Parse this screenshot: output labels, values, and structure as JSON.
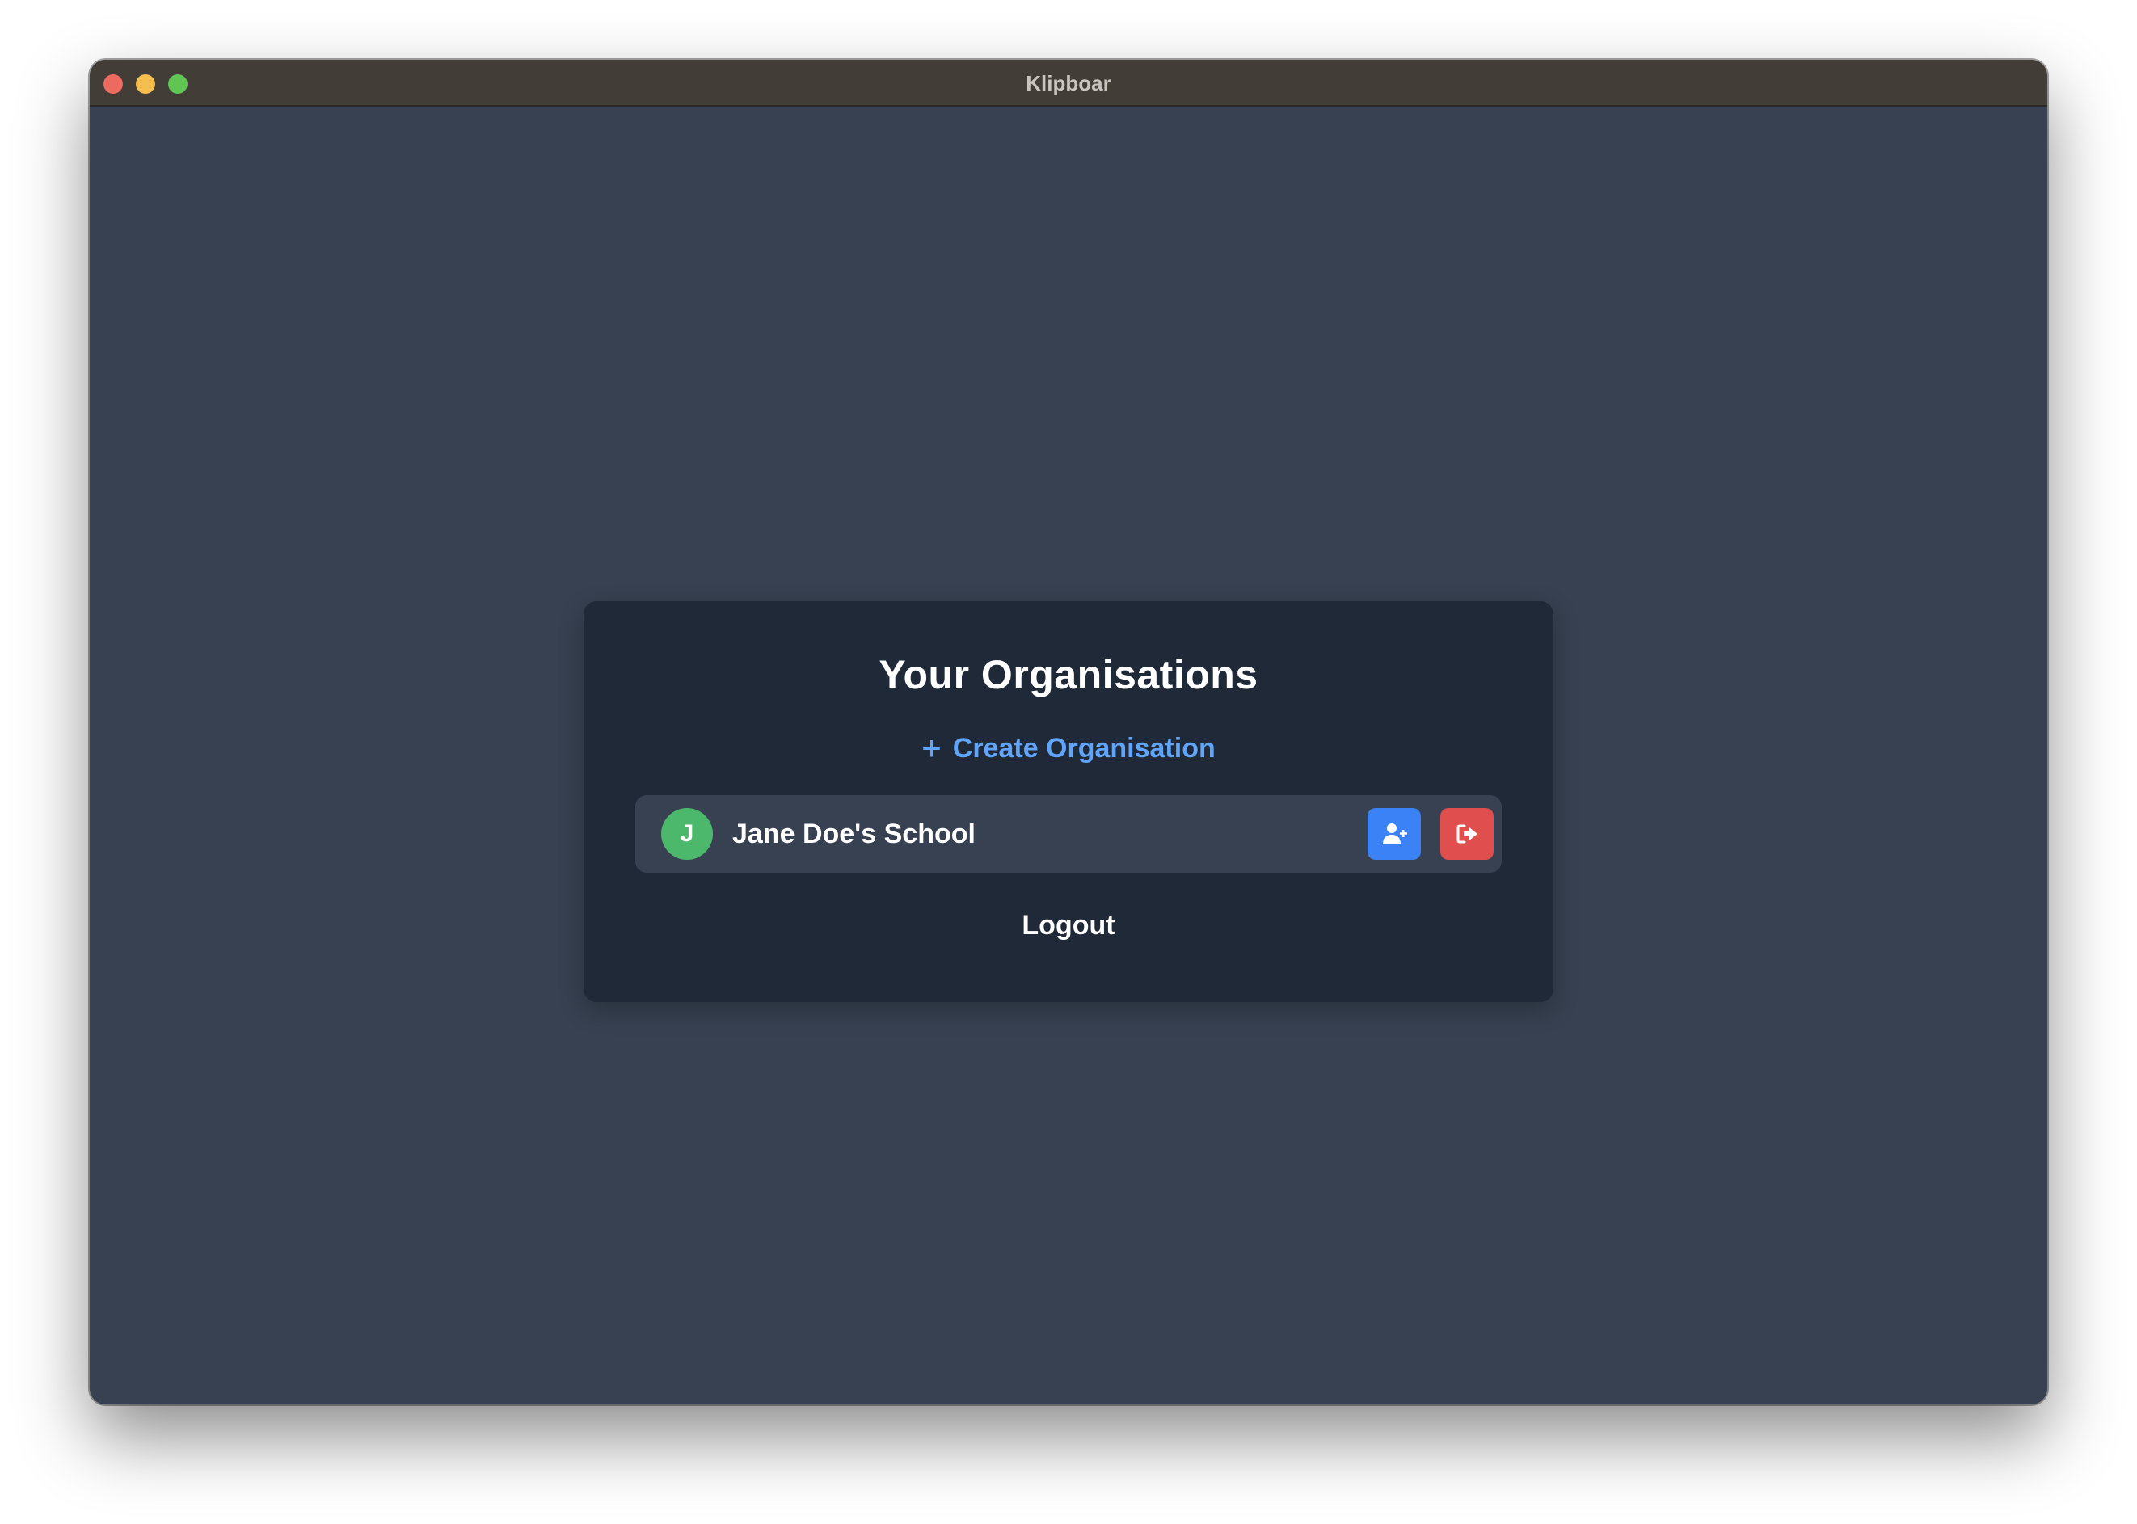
{
  "window": {
    "title": "Klipboar"
  },
  "card": {
    "title": "Your Organisations",
    "create_label": "Create Organisation",
    "create_icon": "plus-icon",
    "logout_label": "Logout"
  },
  "organisations": [
    {
      "avatar_letter": "J",
      "name": "Jane Doe's School",
      "avatar_color": "#4cb86b",
      "actions": [
        {
          "icon": "user-plus-icon",
          "color": "#3b82f6"
        },
        {
          "icon": "sign-out-icon",
          "color": "#e04e4e"
        }
      ]
    }
  ],
  "colors": {
    "background": "#374151",
    "card": "#1f2937",
    "accent": "#60a5fa",
    "titlebar": "#433d38"
  }
}
